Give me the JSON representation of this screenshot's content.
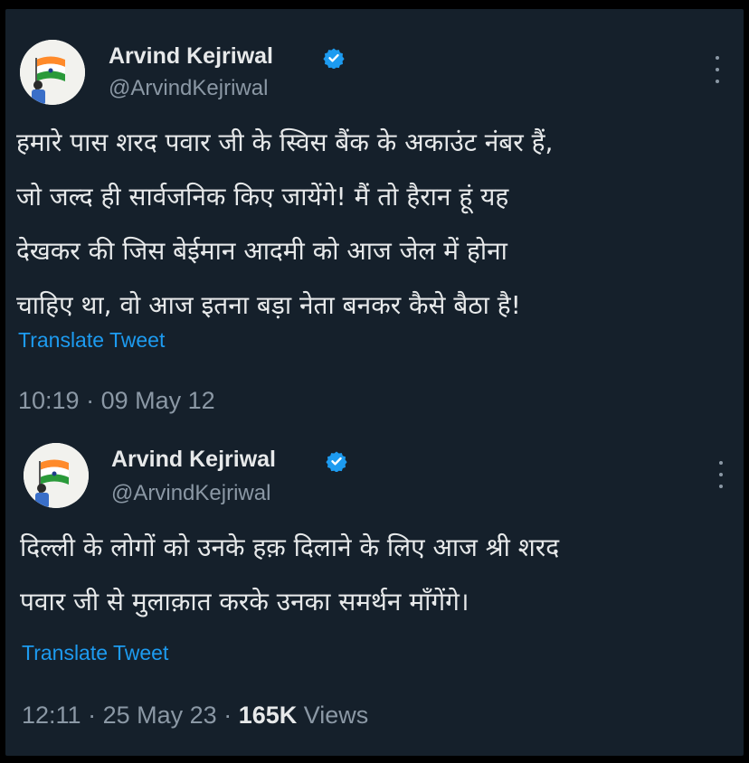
{
  "colors": {
    "background": "#15202b",
    "text": "#e7e9ea",
    "secondary": "#8b98a5",
    "link": "#1d9bf0",
    "verified": "#1d9bf0"
  },
  "tweets": [
    {
      "author_name": "Arvind Kejriwal",
      "handle": "@ArvindKejriwal",
      "lines": [
        "हमारे पास शरद पवार जी के स्विस बैंक के अकाउंट नंबर हैं,",
        "जो जल्द ही सार्वजनिक किए जायेंगे! मैं तो हैरान हूं यह",
        "देखकर की जिस बेईमान आदमी को आज जेल में होना",
        "चाहिए था, वो आज इतना बड़ा नेता बनकर कैसे बैठा है!"
      ],
      "translate_label": "Translate Tweet",
      "time": "10:19",
      "date": "09 May 12"
    },
    {
      "author_name": "Arvind Kejriwal",
      "handle": "@ArvindKejriwal",
      "lines": [
        "दिल्ली के लोगों को उनके हक़ दिलाने के लिए आज श्री शरद",
        "पवार जी से मुलाक़ात करके उनका समर्थन माँगेंगे।"
      ],
      "translate_label": "Translate Tweet",
      "time": "12:11",
      "date": "25 May 23",
      "views_count": "165K",
      "views_label": "Views"
    }
  ],
  "icons": {
    "verified": "verified-badge-icon",
    "more": "more-options-icon"
  }
}
